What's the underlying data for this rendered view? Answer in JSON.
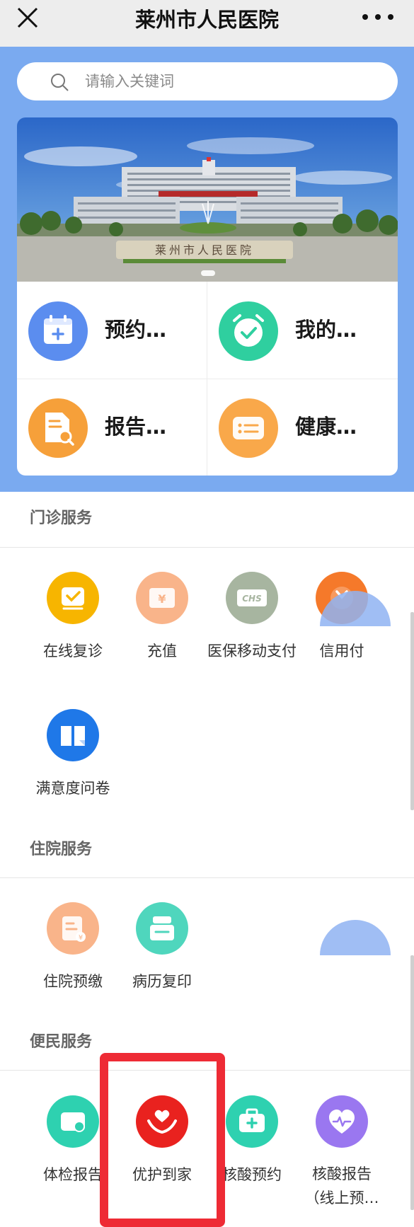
{
  "header": {
    "title": "莱州市人民医院"
  },
  "search": {
    "placeholder": "请输入关键词"
  },
  "banner": {
    "sign_text": "莱州市人民医院"
  },
  "quick_actions": [
    {
      "label": "预约…",
      "icon": "calendar-plus-icon",
      "color": "#5b8def"
    },
    {
      "label": "我的…",
      "icon": "alarm-check-icon",
      "color": "#2fcf9f"
    },
    {
      "label": "报告…",
      "icon": "report-search-icon",
      "color": "#f6a03a"
    },
    {
      "label": "健康…",
      "icon": "health-card-icon",
      "color": "#f9a84a"
    }
  ],
  "sections": {
    "outpatient": {
      "title": "门诊服务",
      "items": [
        {
          "label": "在线复诊",
          "icon": "online-consult-icon",
          "color": "#f7b500"
        },
        {
          "label": "充值",
          "icon": "recharge-card-icon",
          "color": "#f9b48a"
        },
        {
          "label": "医保移动支付",
          "icon": "chs-card-icon",
          "color": "#a7b5a0"
        },
        {
          "label": "信用付",
          "icon": "credit-pay-icon",
          "color": "#f5792a"
        },
        {
          "label": "满意度问卷",
          "icon": "survey-book-icon",
          "color": "#1f78e8"
        }
      ],
      "chs_text": "CHS"
    },
    "inpatient": {
      "title": "住院服务",
      "items": [
        {
          "label": "住院预缴",
          "icon": "prepay-document-icon",
          "color": "#f9b48a"
        },
        {
          "label": "病历复印",
          "icon": "record-copy-icon",
          "color": "#4fd6bd"
        }
      ]
    },
    "convenience": {
      "title": "便民服务",
      "items": [
        {
          "label": "体检报告",
          "icon": "checkup-report-icon",
          "color": "#2ed1b0"
        },
        {
          "label": "优护到家",
          "icon": "care-hands-heart-icon",
          "color": "#e9221f"
        },
        {
          "label": "核酸预约",
          "icon": "medical-kit-icon",
          "color": "#2ed1b0"
        },
        {
          "label": "核酸报告\n（线上预…",
          "icon": "heart-pulse-icon",
          "color": "#9a77f0"
        }
      ]
    }
  }
}
